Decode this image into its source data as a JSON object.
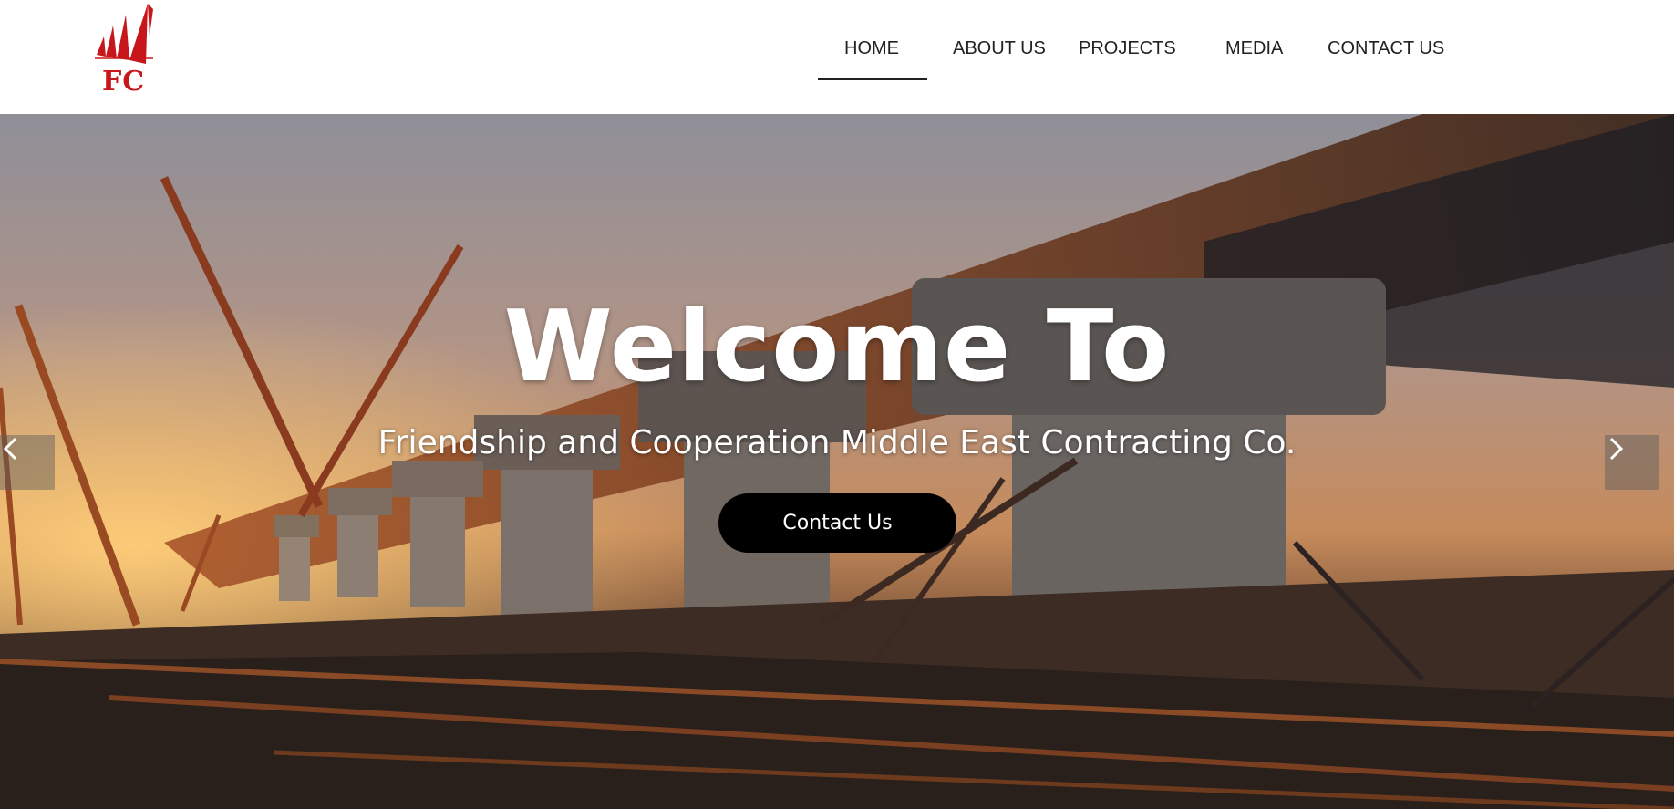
{
  "brand": {
    "logo_text": "FC",
    "accent_color": "#c8161d"
  },
  "nav": {
    "items": [
      {
        "label": "HOME",
        "active": true
      },
      {
        "label": "ABOUT US",
        "active": false
      },
      {
        "label": "PROJECTS",
        "active": false
      },
      {
        "label": "MEDIA",
        "active": false
      },
      {
        "label": "CONTACT US",
        "active": false
      }
    ]
  },
  "hero": {
    "title": "Welcome To",
    "subtitle": "Friendship and Cooperation Middle East Contracting Co.",
    "cta_label": "Contact Us",
    "background": "construction-bridge-photo",
    "prev_icon": "chevron-left-icon",
    "next_icon": "chevron-right-icon"
  }
}
